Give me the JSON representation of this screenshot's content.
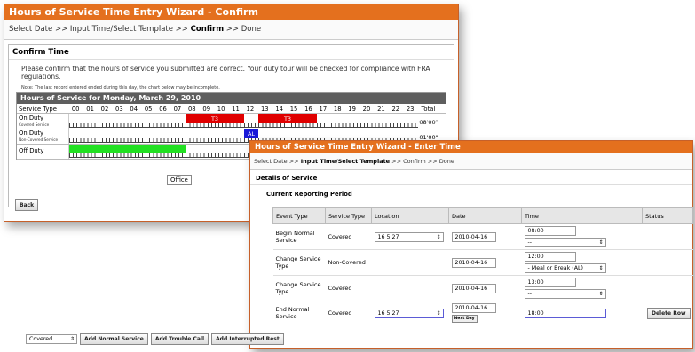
{
  "confirm": {
    "title": "Hours of Service Time Entry Wizard - Confirm",
    "crumb_pre": "Select Date >> Input Time/Select Template >> ",
    "crumb_cur": "Confirm",
    "crumb_post": " >> Done",
    "panel_title": "Confirm Time",
    "message": "Please confirm that the hours of service you submitted are correct. Your duty tour will be checked for compliance with FRA regulations.",
    "note": "Note: The last record entered ended during this day, the chart below may be incomplete.",
    "chart_title": "Hours of Service for Monday, March 29, 2010",
    "col_label": "Service Type",
    "hours": [
      "00",
      "01",
      "02",
      "03",
      "04",
      "05",
      "06",
      "07",
      "08",
      "09",
      "10",
      "11",
      "12",
      "13",
      "14",
      "15",
      "16",
      "17",
      "18",
      "19",
      "20",
      "21",
      "22",
      "23"
    ],
    "total_label": "Total",
    "rows": [
      {
        "label": "On Duty",
        "sub": "Covered Service",
        "total": "08'00\""
      },
      {
        "label": "On Duty",
        "sub": "Non-Covered Service",
        "total": "01'00\""
      },
      {
        "label": "Off Duty",
        "sub": "",
        "total": ""
      }
    ],
    "bar_t3a": "T3",
    "bar_t3b": "T3",
    "bar_al": "AL",
    "office": "Office",
    "back": "Back"
  },
  "enter": {
    "title": "Hours of Service Time Entry Wizard - Enter Time",
    "crumb_pre": "Select Date >> ",
    "crumb_cur": "Input Time/Select Template",
    "crumb_post": " >> Confirm >> Done",
    "section": "Details of Service",
    "sub_section": "Current Reporting Period",
    "headers": [
      "Event Type",
      "Service Type",
      "Location",
      "Date",
      "Time",
      "Status"
    ],
    "rows": [
      {
        "event": "Begin Normal Service",
        "service": "Covered",
        "location": "16 5 27",
        "date": "2010-04-16",
        "time": "08:00",
        "time_sel": "--"
      },
      {
        "event": "Change Service Type",
        "service": "Non-Covered",
        "location": "",
        "date": "2010-04-16",
        "time": "12:00",
        "time_sel": "- Meal or Break (AL)"
      },
      {
        "event": "Change Service Type",
        "service": "Covered",
        "location": "",
        "date": "2010-04-16",
        "time": "13:00",
        "time_sel": "--"
      },
      {
        "event": "End Normal Service",
        "service": "Covered",
        "location": "16 5 27",
        "date": "2010-04-16",
        "time": "18:00",
        "time_sel": ""
      }
    ],
    "next_day": "Next Day",
    "delete_row": "Delete Row",
    "bottom_select": "Covered",
    "add_normal": "Add Normal Service",
    "add_trouble": "Add Trouble Call",
    "add_interrupted": "Add Interrupted Rest"
  },
  "colors": {
    "title_bg": "#e4701e",
    "covered": "#e00000",
    "non_covered": "#1a1ad8",
    "off_duty": "#22e022"
  }
}
